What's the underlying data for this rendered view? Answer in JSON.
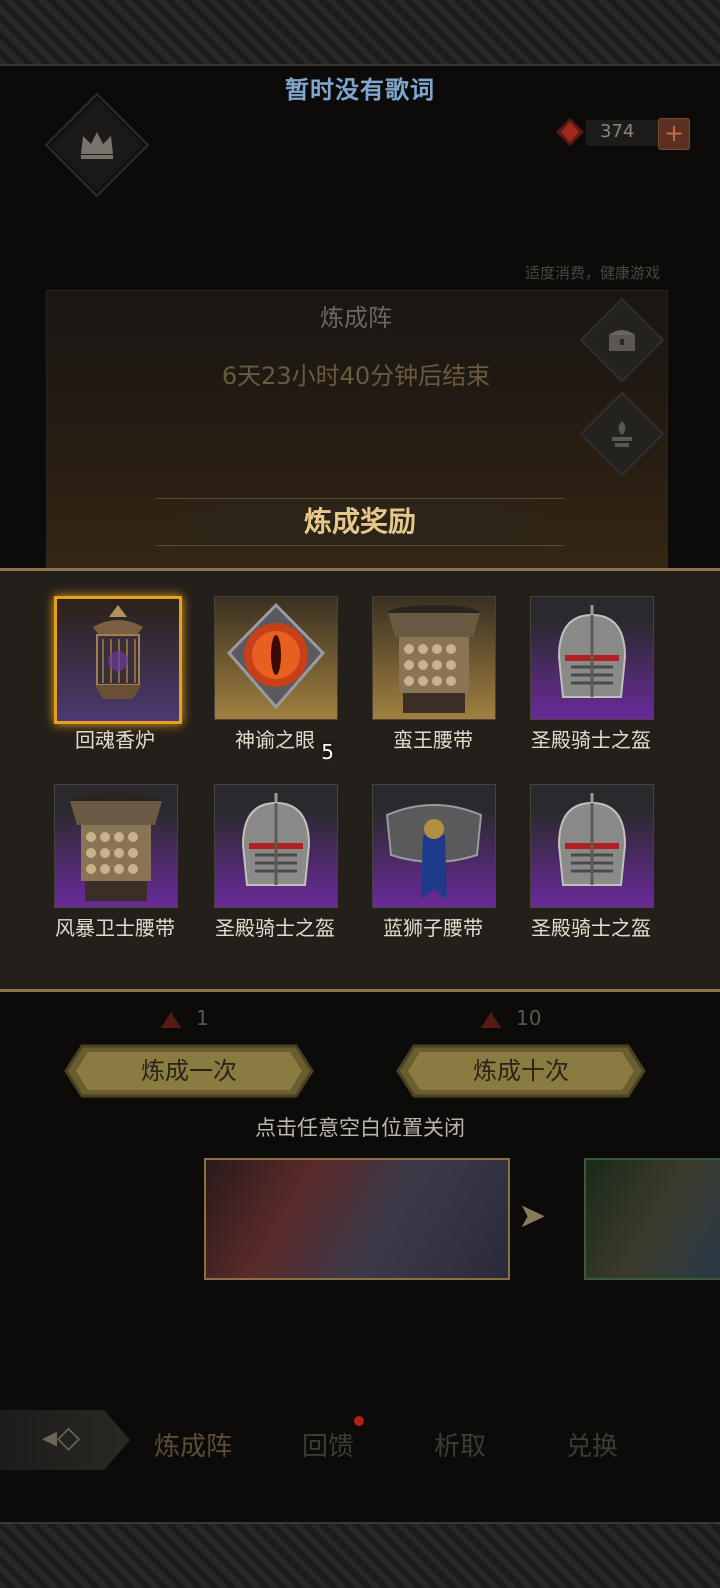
{
  "header": {
    "lyrics": "暂时没有歌词"
  },
  "currency": {
    "amount": "374",
    "plus": "+"
  },
  "health_notice": "适度消费，健康游戏",
  "panel": {
    "title": "炼成阵",
    "timer": "6天23小时40分钟后结束"
  },
  "reward": {
    "title": "炼成奖励",
    "items": [
      {
        "name": "回魂香炉",
        "quantity": "",
        "rarity": "selected",
        "icon": "censer-icon"
      },
      {
        "name": "神谕之眼",
        "quantity": "5",
        "rarity": "gold",
        "icon": "eye-gem-icon"
      },
      {
        "name": "蛮王腰带",
        "quantity": "",
        "rarity": "gold",
        "icon": "belt-icon"
      },
      {
        "name": "圣殿骑士之盔",
        "quantity": "",
        "rarity": "purple",
        "icon": "helmet-icon"
      },
      {
        "name": "风暴卫士腰带",
        "quantity": "",
        "rarity": "purple",
        "icon": "belt-icon"
      },
      {
        "name": "圣殿骑士之盔",
        "quantity": "",
        "rarity": "purple",
        "icon": "helmet-icon"
      },
      {
        "name": "蓝狮子腰带",
        "quantity": "",
        "rarity": "purple",
        "icon": "lion-belt-icon"
      },
      {
        "name": "圣殿骑士之盔",
        "quantity": "",
        "rarity": "purple",
        "icon": "helmet-icon"
      }
    ]
  },
  "actions": {
    "once": {
      "label": "炼成一次",
      "cost": "1"
    },
    "ten": {
      "label": "炼成十次",
      "cost": "10"
    },
    "close_hint": "点击任意空白位置关闭"
  },
  "tabs": [
    {
      "label": "炼成阵",
      "active": true
    },
    {
      "label": "回馈",
      "badge": true
    },
    {
      "label": "析取"
    },
    {
      "label": "兑换"
    }
  ]
}
